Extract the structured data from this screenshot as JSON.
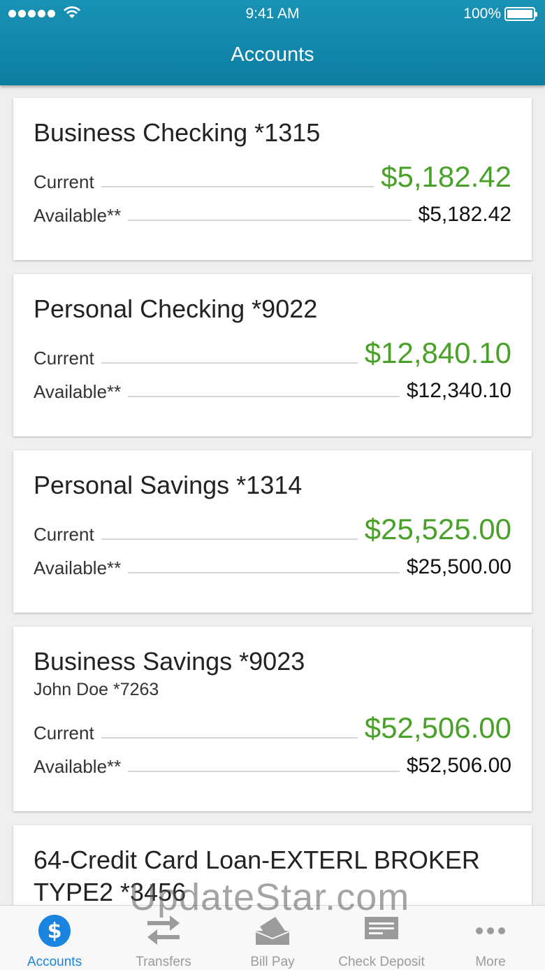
{
  "status": {
    "time": "9:41 AM",
    "battery": "100%"
  },
  "header": {
    "title": "Accounts"
  },
  "accounts": [
    {
      "name": "Business Checking *1315",
      "current_label": "Current",
      "current": "$5,182.42",
      "available_label": "Available**",
      "available": "$5,182.42"
    },
    {
      "name": "Personal Checking *9022",
      "current_label": "Current",
      "current": "$12,840.10",
      "available_label": "Available**",
      "available": "$12,340.10"
    },
    {
      "name": "Personal Savings *1314",
      "current_label": "Current",
      "current": "$25,525.00",
      "available_label": "Available**",
      "available": "$25,500.00"
    },
    {
      "name": "Business Savings *9023",
      "sub": "John Doe *7263",
      "current_label": "Current",
      "current": "$52,506.00",
      "available_label": "Available**",
      "available": "$52,506.00"
    },
    {
      "name_line1": "64-Credit Card Loan-EXTERL BROKER",
      "name_line2": "TYPE2 *3456"
    }
  ],
  "tabs": [
    {
      "label": "Accounts",
      "icon": "dollar-icon",
      "active": true
    },
    {
      "label": "Transfers",
      "icon": "transfer-arrows-icon"
    },
    {
      "label": "Bill Pay",
      "icon": "bill-pay-icon"
    },
    {
      "label": "Check Deposit",
      "icon": "check-deposit-icon"
    },
    {
      "label": "More",
      "icon": "more-dots-icon"
    }
  ],
  "watermark": "UpdateStar.com",
  "colors": {
    "header": "#1289ad",
    "positive": "#4aa12a",
    "tab_active": "#1a84e0",
    "tab_inactive": "#9b9b9b"
  }
}
